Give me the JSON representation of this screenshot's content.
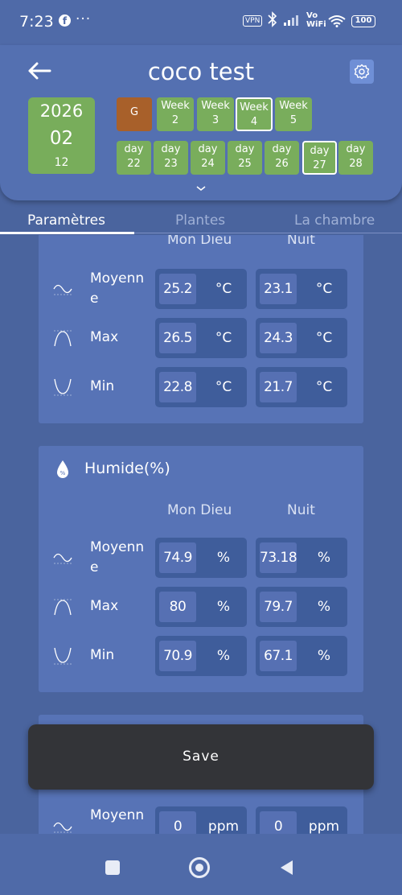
{
  "status": {
    "time": "7:23",
    "facebook_glyph": "f",
    "more_dots": "···",
    "vpn": "VPN",
    "vowifi_top": "Vo",
    "vowifi_bottom": "WiFi",
    "battery": "100",
    "icons": [
      "facebook-icon",
      "bluetooth-icon",
      "signal-icon",
      "wifi-icon",
      "battery-icon"
    ]
  },
  "header": {
    "title": "coco test",
    "date": {
      "year": "2026",
      "month": "02",
      "day": "12"
    },
    "stage": "G",
    "weeks": [
      {
        "line1": "Week",
        "line2": "2",
        "selected": false
      },
      {
        "line1": "Week",
        "line2": "3",
        "selected": false
      },
      {
        "line1": "Week",
        "line2": "4",
        "selected": true
      },
      {
        "line1": "Week",
        "line2": "5",
        "selected": false
      }
    ],
    "days": [
      {
        "line1": "day",
        "line2": "22",
        "selected": false
      },
      {
        "line1": "day",
        "line2": "23",
        "selected": false
      },
      {
        "line1": "day",
        "line2": "24",
        "selected": false
      },
      {
        "line1": "day",
        "line2": "25",
        "selected": false
      },
      {
        "line1": "day",
        "line2": "26",
        "selected": false
      },
      {
        "line1": "day",
        "line2": "27",
        "selected": true
      },
      {
        "line1": "day",
        "line2": "28",
        "selected": false
      }
    ]
  },
  "tabs": [
    {
      "label": "Paramètres",
      "active": true
    },
    {
      "label": "Plantes",
      "active": false
    },
    {
      "label": "La chambre",
      "active": false
    }
  ],
  "temperature": {
    "col_day": "Mon Dieu",
    "col_night": "Nuit",
    "rows": [
      {
        "label_line1": "Moyenn",
        "label_line2": "e",
        "day": "25.2",
        "night": "23.1",
        "unit": "°C"
      },
      {
        "label_line1": "Max",
        "label_line2": "",
        "day": "26.5",
        "night": "24.3",
        "unit": "°C"
      },
      {
        "label_line1": "Min",
        "label_line2": "",
        "day": "22.8",
        "night": "21.7",
        "unit": "°C"
      }
    ]
  },
  "humidity": {
    "title": "Humide(%)",
    "col_day": "Mon Dieu",
    "col_night": "Nuit",
    "rows": [
      {
        "label_line1": "Moyenn",
        "label_line2": "e",
        "day": "74.9",
        "night": "73.18",
        "unit": "%"
      },
      {
        "label_line1": "Max",
        "label_line2": "",
        "day": "80",
        "night": "79.7",
        "unit": "%"
      },
      {
        "label_line1": "Min",
        "label_line2": "",
        "day": "70.9",
        "night": "67.1",
        "unit": "%"
      }
    ]
  },
  "co2": {
    "rows": [
      {
        "label_line1": "Moyenn",
        "day": "0",
        "night": "0",
        "unit": "ppm"
      }
    ]
  },
  "save_label": "Save",
  "colors": {
    "background": "#4a649e",
    "header": "#5470b1",
    "card": "#5773b6",
    "chip_green": "#79ad5c",
    "stage_brown": "#a8602a",
    "save_button": "#333438"
  }
}
